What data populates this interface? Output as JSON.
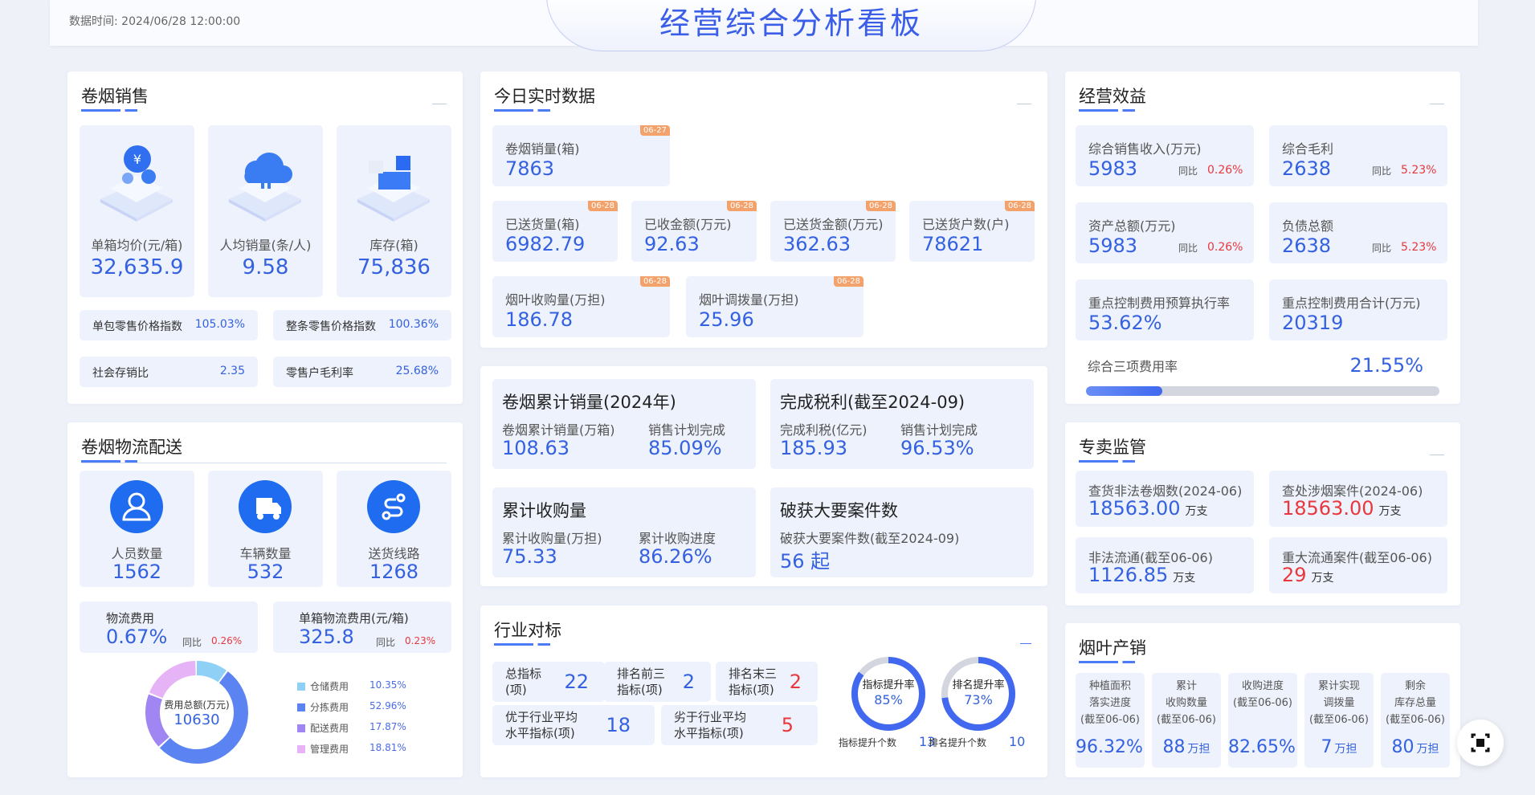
{
  "header": {
    "datatime_label": "数据时间:",
    "datatime": "2024/06/28 12:00:00",
    "title": "经营综合分析看板"
  },
  "sales": {
    "title": "卷烟销售",
    "cards": [
      {
        "label": "单箱均价(元/箱)",
        "value": "32,635.9"
      },
      {
        "label": "人均销量(条/人)",
        "value": "9.58"
      },
      {
        "label": "库存(箱)",
        "value": "75,836"
      }
    ],
    "indexes": [
      {
        "label": "单包零售价格指数",
        "value": "105.03%"
      },
      {
        "label": "整条零售价格指数",
        "value": "100.36%"
      },
      {
        "label": "社会存销比",
        "value": "2.35"
      },
      {
        "label": "零售户毛利率",
        "value": "25.68%"
      }
    ]
  },
  "logistics": {
    "title": "卷烟物流配送",
    "cards": [
      {
        "label": "人员数量",
        "value": "1562"
      },
      {
        "label": "车辆数量",
        "value": "532"
      },
      {
        "label": "送货线路",
        "value": "1268"
      }
    ],
    "fees": [
      {
        "label": "物流费用",
        "value": "0.67%",
        "yoy_label": "同比",
        "yoy": "0.26%"
      },
      {
        "label": "单箱物流费用(元/箱)",
        "value": "325.8",
        "yoy_label": "同比",
        "yoy": "0.23%"
      }
    ],
    "donut": {
      "center_label": "费用总额(万元)",
      "center_value": "10630",
      "items": [
        {
          "name": "仓储费用",
          "pct": "10.35%",
          "value": 10.35,
          "color": "#8fd0f6"
        },
        {
          "name": "分拣费用",
          "pct": "52.96%",
          "value": 52.96,
          "color": "#5b84f2"
        },
        {
          "name": "配送费用",
          "pct": "17.87%",
          "value": 17.87,
          "color": "#9f86f2"
        },
        {
          "name": "管理费用",
          "pct": "18.81%",
          "value": 18.81,
          "color": "#e6b4f6"
        }
      ]
    }
  },
  "realtime": {
    "title": "今日实时数据",
    "row1": [
      {
        "label": "卷烟销量(箱)",
        "value": "7863",
        "tag": "06-27"
      }
    ],
    "row2": [
      {
        "label": "已送货量(箱)",
        "value": "6982.79",
        "tag": "06-28"
      },
      {
        "label": "已收金额(万元)",
        "value": "92.63",
        "tag": "06-28"
      },
      {
        "label": "已送货金额(万元)",
        "value": "362.63",
        "tag": "06-28"
      },
      {
        "label": "已送货户数(户)",
        "value": "78621",
        "tag": "06-28"
      }
    ],
    "row3": [
      {
        "label": "烟叶收购量(万担)",
        "value": "186.78",
        "tag": "06-28"
      },
      {
        "label": "烟叶调拨量(万担)",
        "value": "25.96",
        "tag": "06-28"
      }
    ]
  },
  "cumulative": [
    {
      "title": "卷烟累计销量(2024年)",
      "items": [
        {
          "label": "卷烟累计销量(万箱)",
          "value": "108.63"
        },
        {
          "label": "销售计划完成",
          "value": "85.09%"
        }
      ]
    },
    {
      "title": "完成税利(截至2024-09)",
      "items": [
        {
          "label": "完成利税(亿元)",
          "value": "185.93"
        },
        {
          "label": "销售计划完成",
          "value": "96.53%"
        }
      ]
    },
    {
      "title": "累计收购量",
      "items": [
        {
          "label": "累计收购量(万担)",
          "value": "75.33"
        },
        {
          "label": "累计收购进度",
          "value": "86.26%"
        }
      ]
    },
    {
      "title": "破获大要案件数",
      "items": [
        {
          "label": "破获大要案件数(截至2024-09)",
          "value": "56 起"
        }
      ]
    }
  ],
  "benchmark": {
    "title": "行业对标",
    "cells": [
      {
        "label": "总指标\n(项)",
        "value": "22"
      },
      {
        "label": "排名前三\n指标(项)",
        "value": "2"
      },
      {
        "label": "排名末三\n指标(项)",
        "value": "2",
        "red": true
      },
      {
        "label": "优于行业平均\n水平指标(项)",
        "value": "18"
      },
      {
        "label": "劣于行业平均\n水平指标(项)",
        "value": "5",
        "red": true
      }
    ],
    "rings": [
      {
        "title": "指标提升率",
        "pct": "85%",
        "value": 85,
        "foot": "指标提升个数",
        "count": "13"
      },
      {
        "title": "排名提升率",
        "pct": "73%",
        "value": 73,
        "foot": "排名提升个数",
        "count": "10"
      }
    ]
  },
  "benefit": {
    "title": "经营效益",
    "cards": [
      {
        "label": "综合销售收入(万元)",
        "value": "5983",
        "yoy_label": "同比",
        "yoy": "0.26%"
      },
      {
        "label": "综合毛利",
        "value": "2638",
        "yoy_label": "同比",
        "yoy": "5.23%"
      },
      {
        "label": "资产总额(万元)",
        "value": "5983",
        "yoy_label": "同比",
        "yoy": "0.26%"
      },
      {
        "label": "负债总额",
        "value": "2638",
        "yoy_label": "同比",
        "yoy": "5.23%"
      },
      {
        "label": "重点控制费用预算执行率",
        "value": "53.62%"
      },
      {
        "label": "重点控制费用合计(万元)",
        "value": "20319"
      }
    ],
    "rate": {
      "label": "综合三项费用率",
      "value": "21.55%",
      "fraction": 0.2155
    }
  },
  "monopoly": {
    "title": "专卖监管",
    "cards": [
      {
        "label": "查货非法卷烟数(2024-06)",
        "value": "18563.00",
        "unit": "万支"
      },
      {
        "label": "查处涉烟案件(2024-06)",
        "value": "18563.00",
        "unit": "万支",
        "red": true
      },
      {
        "label": "非法流通(截至06-06)",
        "value": "1126.85",
        "unit": "万支"
      },
      {
        "label": "重大流通案件(截至06-06)",
        "value": "29",
        "unit": "万支",
        "red": true
      }
    ]
  },
  "leaf": {
    "title": "烟叶产销",
    "cards": [
      {
        "label": "种植面积\n落实进度\n(截至06-06)",
        "value": "96.32%",
        "unit": ""
      },
      {
        "label": "累计\n收购数量\n(截至06-06)",
        "value": "88",
        "unit": "万担"
      },
      {
        "label": "收购进度\n(截至06-06)",
        "value": "82.65%",
        "unit": ""
      },
      {
        "label": "累计实现\n调拨量\n(截至06-06)",
        "value": "7",
        "unit": "万担"
      },
      {
        "label": "剩余\n库存总量\n(截至06-06)",
        "value": "80",
        "unit": "万担"
      }
    ]
  },
  "icons": {
    "fullscreen": "fullscreen-icon",
    "person": "person-icon",
    "truck": "truck-icon",
    "route": "route-icon"
  }
}
